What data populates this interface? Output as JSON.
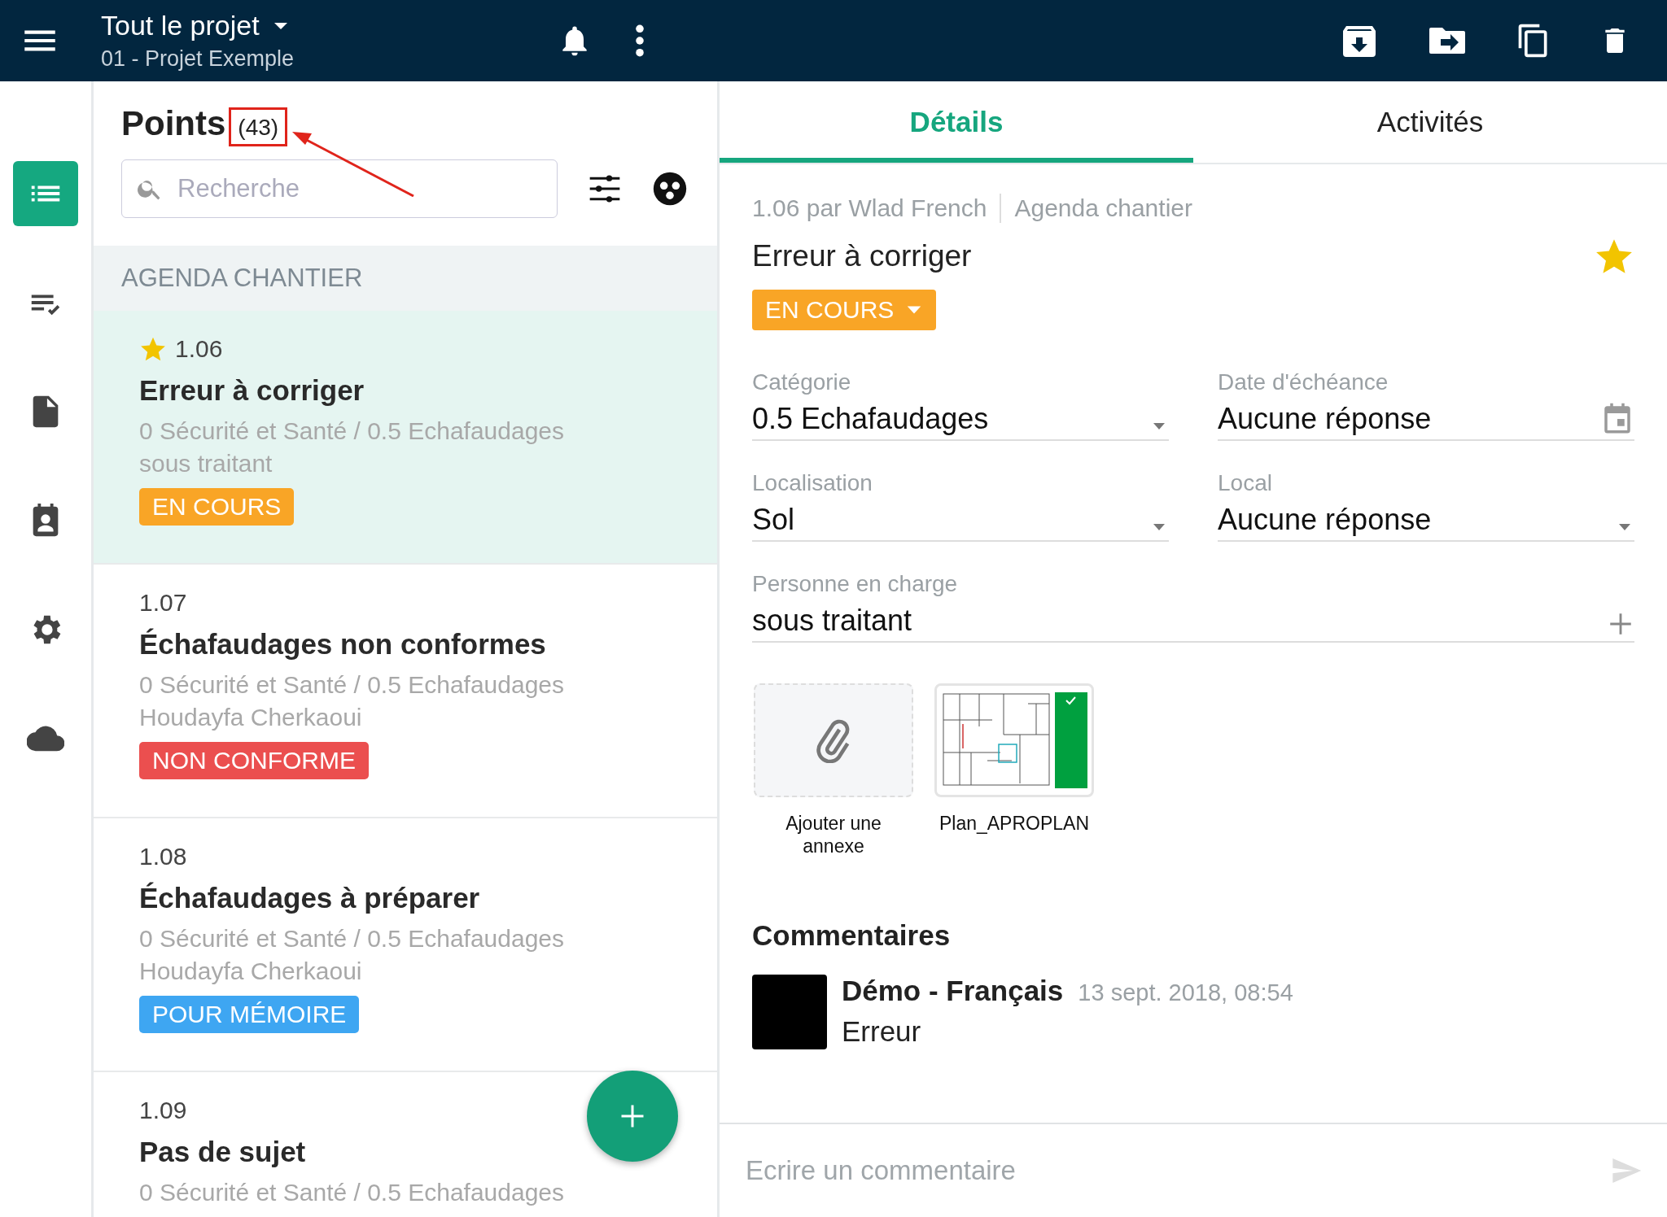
{
  "top_bar": {
    "title": "Tout le projet",
    "subtitle": "01 - Projet Exemple"
  },
  "rail": [
    {
      "selected": true
    },
    {
      "selected": false
    },
    {
      "selected": false
    },
    {
      "selected": false
    },
    {
      "selected": false
    },
    {
      "selected": false
    }
  ],
  "list": {
    "title": "Points",
    "count": "(43)",
    "search": {
      "placeholder": "Recherche"
    },
    "section": "AGENDA CHANTIER",
    "items": [
      {
        "number": "1.06",
        "starred": true,
        "title": "Erreur à corriger",
        "category": "0 Sécurité et Santé / 0.5 Echafaudages",
        "assignee": "sous traitant",
        "status": "EN COURS",
        "color": "#f9a526",
        "selected": true
      },
      {
        "number": "1.07",
        "starred": false,
        "title": "Échafaudages non conformes",
        "category": "0 Sécurité et Santé / 0.5 Echafaudages",
        "assignee": "Houdayfa Cherkaoui",
        "status": "NON CONFORME",
        "color": "#eb4f4f",
        "selected": false
      },
      {
        "number": "1.08",
        "starred": false,
        "title": "Échafaudages à préparer",
        "category": "0 Sécurité et Santé / 0.5 Echafaudages",
        "assignee": "Houdayfa Cherkaoui",
        "status": "POUR MÉMOIRE",
        "color": "#3ea6f2",
        "selected": false
      },
      {
        "number": "1.09",
        "starred": false,
        "title": "Pas de sujet",
        "category": "0 Sécurité et Santé / 0.5 Echafaudages",
        "selected": false
      }
    ]
  },
  "tabs": [
    {
      "label": "Détails",
      "selected": true
    },
    {
      "label": "Activités",
      "selected": false
    }
  ],
  "detail": {
    "meta_number": "1.06 par Wlad French",
    "meta_list": "Agenda chantier",
    "title": "Erreur à corriger",
    "starred": true,
    "status": "EN COURS",
    "color": "#f9a526",
    "fields": [
      {
        "label": "Catégorie",
        "value": "0.5 Echafaudages",
        "kind": "dropdown"
      },
      {
        "label": "Date d'échéance",
        "value": "Aucune réponse",
        "kind": "date"
      },
      {
        "label": "Localisation",
        "value": "Sol",
        "kind": "dropdown"
      },
      {
        "label": "Local",
        "value": "Aucune réponse",
        "kind": "dropdown"
      },
      {
        "label": "Personne en charge",
        "value": "sous traitant",
        "kind": "add"
      }
    ],
    "attachments": [
      {
        "kind": "add",
        "label": "Ajouter une annexe"
      },
      {
        "kind": "plan",
        "label": "Plan_APROPLAN"
      }
    ]
  },
  "comments": {
    "title": "Commentaires",
    "items": [
      {
        "author": "Démo - Français",
        "date": "13 sept. 2018, 08:54",
        "text": "Erreur"
      }
    ],
    "input": {
      "placeholder": "Ecrire un commentaire"
    }
  }
}
